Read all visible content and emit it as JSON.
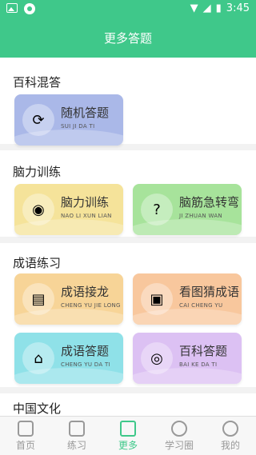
{
  "status": {
    "time": "3:45"
  },
  "header": {
    "title": "更多答题"
  },
  "sections": [
    {
      "title": "百科混答",
      "cards": [
        {
          "title": "随机答题",
          "subtitle": "SUI JI DA TI",
          "icon": "refresh-icon",
          "color": "#aab8e8"
        }
      ]
    },
    {
      "title": "脑力训练",
      "cards": [
        {
          "title": "脑力训练",
          "subtitle": "NAO LI XUN LIAN",
          "icon": "girl-avatar-icon",
          "color": "#f5e39a"
        },
        {
          "title": "脑筋急转弯",
          "subtitle": "JI ZHUAN WAN",
          "icon": "question-icon",
          "color": "#a7e39b"
        }
      ]
    },
    {
      "title": "成语练习",
      "cards": [
        {
          "title": "成语接龙",
          "subtitle": "CHENG YU JIE LONG",
          "icon": "book-icon",
          "color": "#f7d497"
        },
        {
          "title": "看图猜成语",
          "subtitle": "CAI CHENG YU",
          "icon": "picture-icon",
          "color": "#f8c79d"
        },
        {
          "title": "成语答题",
          "subtitle": "CHENG YU DA TI",
          "icon": "pavilion-icon",
          "color": "#8fe1e8"
        },
        {
          "title": "百科答题",
          "subtitle": "BAI KE DA TI",
          "icon": "planet-icon",
          "color": "#dcc1f3"
        }
      ]
    },
    {
      "title": "中国文化"
    }
  ],
  "nav": [
    {
      "label": "首页",
      "icon": "home-icon",
      "active": false
    },
    {
      "label": "练习",
      "icon": "practice-icon",
      "active": false
    },
    {
      "label": "更多",
      "icon": "more-icon",
      "active": true
    },
    {
      "label": "学习圈",
      "icon": "chat-icon",
      "active": false
    },
    {
      "label": "我的",
      "icon": "profile-icon",
      "active": false
    }
  ]
}
